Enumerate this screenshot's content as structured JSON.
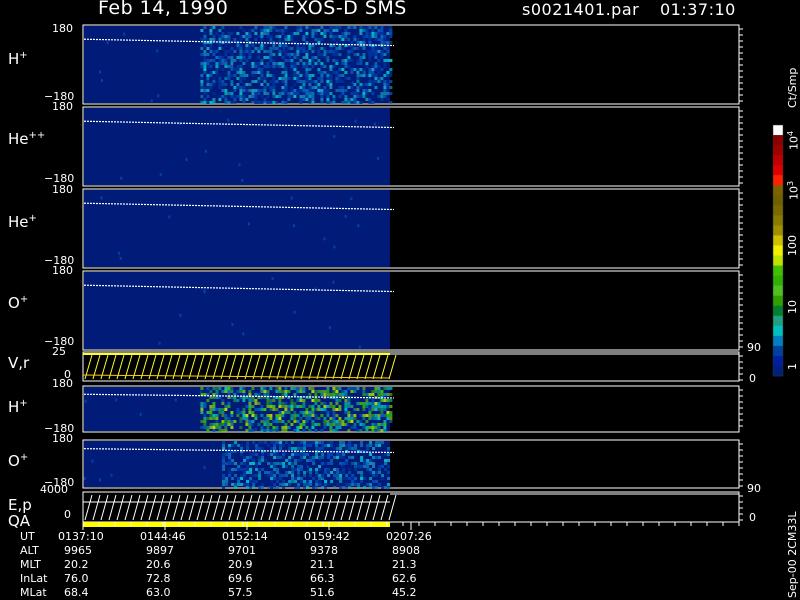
{
  "header": {
    "date": "Feb 14, 1990",
    "instrument": "EXOS-D SMS",
    "file": "s0021401.par",
    "time": "01:37:10"
  },
  "panels": [
    {
      "id": "hplus",
      "name": "H",
      "sup": "+",
      "ytop": "180",
      "ybot": "−180"
    },
    {
      "id": "hepp",
      "name": "He",
      "sup": "++",
      "ytop": "180",
      "ybot": "−180"
    },
    {
      "id": "heplus",
      "name": "He",
      "sup": "+",
      "ytop": "180",
      "ybot": "−180"
    },
    {
      "id": "oplus",
      "name": "O",
      "sup": "+",
      "ytop": "180",
      "ybot": "−180"
    },
    {
      "id": "vr",
      "name": "V,r",
      "sup": "",
      "ytop": "25",
      "ybot": "0",
      "rtop": "90",
      "rbot": "0"
    },
    {
      "id": "hplus2",
      "name": "H",
      "sup": "+",
      "ytop": "180",
      "ybot": "−180"
    },
    {
      "id": "oplus2",
      "name": "O",
      "sup": "+",
      "ytop": "180",
      "ybot": "−180"
    },
    {
      "id": "ep",
      "name": "E,p",
      "sup": "",
      "name2": "QA",
      "ytop": "4000",
      "ybot": "0",
      "rtop": "90",
      "rbot": "0"
    }
  ],
  "colorbar": {
    "unit": "Ct/Smp",
    "ticks": [
      {
        "base": "10",
        "exp": "4"
      },
      {
        "base": "10",
        "exp": "3"
      },
      {
        "base": "100",
        "exp": ""
      },
      {
        "base": "10",
        "exp": ""
      },
      {
        "base": "1",
        "exp": ""
      }
    ],
    "colors": [
      "#ffffff",
      "#8b0000",
      "#a00000",
      "#c00000",
      "#e00000",
      "#ff2000",
      "#806000",
      "#706000",
      "#7a6a00",
      "#8a7a00",
      "#a09000",
      "#d0c000",
      "#f0f000",
      "#c0e000",
      "#40c000",
      "#30b000",
      "#50c020",
      "#30a000",
      "#008030",
      "#20a080",
      "#00c0c0",
      "#0080c0",
      "#0040a0",
      "#0020a0",
      "#002080"
    ]
  },
  "ephemeris": {
    "labels": [
      "UT",
      "ALT",
      "MLT",
      "InLat",
      "MLat"
    ],
    "columns": [
      [
        "0137:10",
        "9965",
        "20.2",
        "76.0",
        "68.4"
      ],
      [
        "0144:46",
        "9897",
        "20.6",
        "72.8",
        "63.0"
      ],
      [
        "0152:14",
        "9701",
        "20.9",
        "69.6",
        "57.5"
      ],
      [
        "0159:42",
        "9378",
        "21.1",
        "66.3",
        "51.6"
      ],
      [
        "0207:26",
        "8908",
        "21.3",
        "62.6",
        "45.2"
      ]
    ]
  },
  "footer_code": "Sep-00 2CM33L",
  "colors": {
    "background": "#000000",
    "spectrogram_base": "#001c78",
    "velocity_trace": "#ffff30",
    "qa_bar": "#ffff00",
    "frame": "#ffffff"
  },
  "chart_data": {
    "type": "heatmap",
    "title": "Feb 14, 1990   EXOS-D SMS",
    "subtitle": "s0021401.par  01:37:10",
    "x_ticks": [
      "0137:10",
      "0144:46",
      "0152:14",
      "0159:42",
      "0207:26"
    ],
    "data_coverage_end": "0207:26",
    "colorbar_label": "Ct/Smp",
    "color_scale": "log",
    "color_range": [
      1,
      10000
    ],
    "series": [
      {
        "name": "H+",
        "ylim": [
          -180,
          180
        ],
        "enhanced_from": "0148:00",
        "enhanced_to": "0207:00"
      },
      {
        "name": "He++",
        "ylim": [
          -180,
          180
        ]
      },
      {
        "name": "He+",
        "ylim": [
          -180,
          180
        ]
      },
      {
        "name": "O+",
        "ylim": [
          -180,
          180
        ]
      },
      {
        "name": "V,r",
        "ylim": [
          0,
          25
        ],
        "ylim_right": [
          0,
          90
        ]
      },
      {
        "name": "H+",
        "ylim": [
          -180,
          180
        ],
        "enhanced_from": "0148:00",
        "enhanced_to": "0207:00"
      },
      {
        "name": "O+",
        "ylim": [
          -180,
          180
        ],
        "enhanced_from": "0150:00",
        "enhanced_to": "0207:00"
      },
      {
        "name": "E,p",
        "ylim": [
          0,
          4000
        ],
        "ylim_right": [
          0,
          90
        ]
      }
    ]
  }
}
